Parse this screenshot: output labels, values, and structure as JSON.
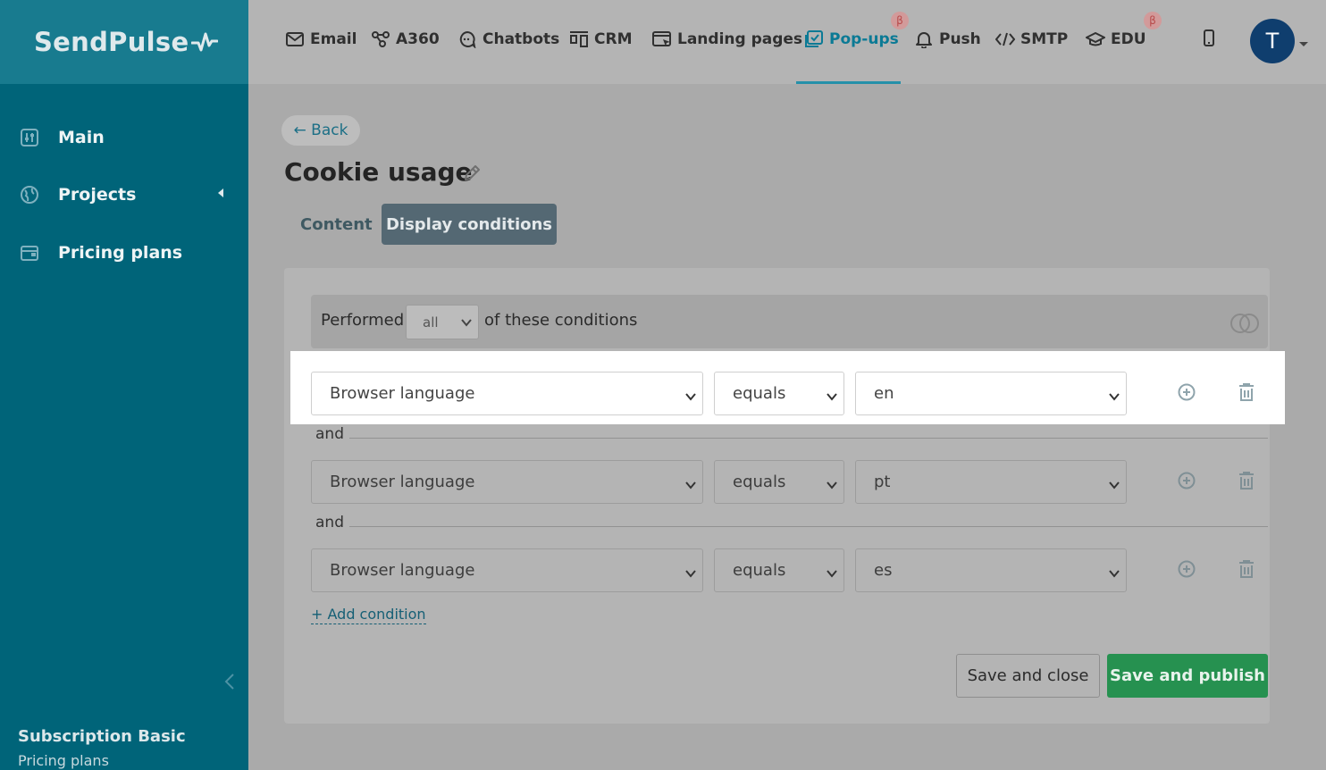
{
  "brand": {
    "logo_text": "SendPulse"
  },
  "sidebar": {
    "items": [
      {
        "label": "Main",
        "icon": "sliders-icon"
      },
      {
        "label": "Projects",
        "icon": "globe-icon"
      },
      {
        "label": "Pricing plans",
        "icon": "wallet-icon"
      }
    ],
    "subscription_title": "Subscription Basic",
    "subscription_link": "Pricing plans"
  },
  "topnav": {
    "items": [
      {
        "label": "Email",
        "icon": "envelope-icon"
      },
      {
        "label": "A360",
        "icon": "nodes-icon"
      },
      {
        "label": "Chatbots",
        "icon": "chat-icon"
      },
      {
        "label": "CRM",
        "icon": "kanban-icon"
      },
      {
        "label": "Landing pages",
        "icon": "cursor-window-icon"
      },
      {
        "label": "Pop-ups",
        "icon": "popup-check-icon",
        "active": true
      },
      {
        "label": "Push",
        "icon": "bell-icon"
      },
      {
        "label": "SMTP",
        "icon": "code-icon"
      },
      {
        "label": "EDU",
        "icon": "graduation-cap-icon"
      }
    ],
    "beta_badge": "β",
    "avatar_letter": "T"
  },
  "page": {
    "back_label": "← Back",
    "title": "Cookie usage",
    "tabs": [
      {
        "label": "Content",
        "active": false
      },
      {
        "label": "Display conditions",
        "active": true
      }
    ]
  },
  "conditions": {
    "performed_label": "Performed",
    "match_value": "all",
    "of_label": "of these conditions",
    "joiner": "and",
    "rows": [
      {
        "field": "Browser language",
        "operator": "equals",
        "value": "en"
      },
      {
        "field": "Browser language",
        "operator": "equals",
        "value": "pt"
      },
      {
        "field": "Browser language",
        "operator": "equals",
        "value": "es"
      }
    ],
    "add_label": "+ Add condition"
  },
  "actions": {
    "save_close": "Save and close",
    "save_publish": "Save and publish"
  },
  "colors": {
    "sidebar_bg": "#006479",
    "accent": "#0b7a95",
    "publish_green": "#269150",
    "avatar_bg": "#0f3e6e"
  }
}
